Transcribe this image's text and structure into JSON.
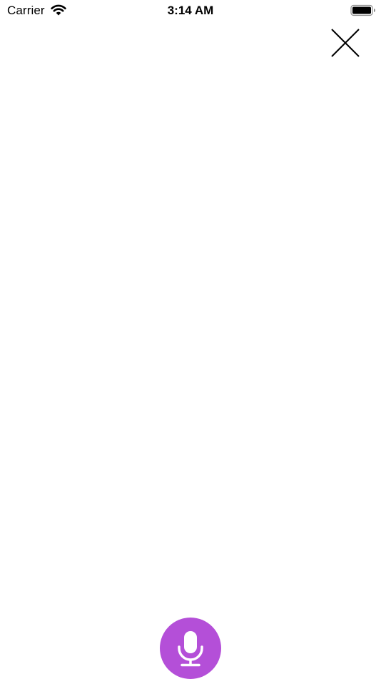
{
  "status_bar": {
    "carrier": "Carrier",
    "time": "3:14 AM",
    "wifi_icon": "wifi-icon",
    "battery_icon": "battery-icon"
  },
  "close_button": {
    "icon": "close-icon"
  },
  "mic_button": {
    "icon": "microphone-icon",
    "color": "#b44fd8"
  }
}
